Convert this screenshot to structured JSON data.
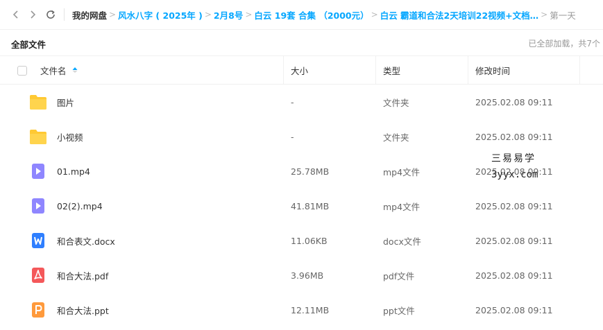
{
  "nav": {
    "back_icon": "chevron-left-icon",
    "forward_icon": "chevron-right-icon",
    "refresh_icon": "refresh-icon"
  },
  "breadcrumb": {
    "root": "我的网盘",
    "crumbs": [
      "风水八字 ( 2025年 )",
      "2月8号",
      "白云 19套 合集 （2000元）",
      "白云 霸道和合法2天培训22视频+文档…"
    ],
    "current": "第一天",
    "separator": ">"
  },
  "subhead": {
    "title": "全部文件",
    "status": "已全部加载，共7个"
  },
  "columns": {
    "name": "文件名",
    "size": "大小",
    "type": "类型",
    "modified": "修改时间"
  },
  "files": [
    {
      "icon": "folder-icon",
      "name": "图片",
      "size": "-",
      "type": "文件夹",
      "modified": "2025.02.08 09:11"
    },
    {
      "icon": "folder-icon",
      "name": "小视频",
      "size": "-",
      "type": "文件夹",
      "modified": "2025.02.08 09:11"
    },
    {
      "icon": "video-file-icon",
      "name": "01.mp4",
      "size": "25.78MB",
      "type": "mp4文件",
      "modified": "2025.02.08 09:11"
    },
    {
      "icon": "video-file-icon",
      "name": "02(2).mp4",
      "size": "41.81MB",
      "type": "mp4文件",
      "modified": "2025.02.08 09:11"
    },
    {
      "icon": "word-file-icon",
      "name": "和合表文.docx",
      "size": "11.06KB",
      "type": "docx文件",
      "modified": "2025.02.08 09:11"
    },
    {
      "icon": "pdf-file-icon",
      "name": "和合大法.pdf",
      "size": "3.96MB",
      "type": "pdf文件",
      "modified": "2025.02.08 09:11"
    },
    {
      "icon": "ppt-file-icon",
      "name": "和合大法.ppt",
      "size": "12.11MB",
      "type": "ppt文件",
      "modified": "2025.02.08 09:11"
    }
  ],
  "watermark": {
    "line1": "三易易学",
    "line2": "3yyx.com"
  },
  "colors": {
    "accent": "#06a7ff",
    "folder": "#ffc933",
    "video": "#8f86ff",
    "word": "#2f7fff",
    "pdf": "#f4585a",
    "ppt": "#ff9a3c"
  }
}
